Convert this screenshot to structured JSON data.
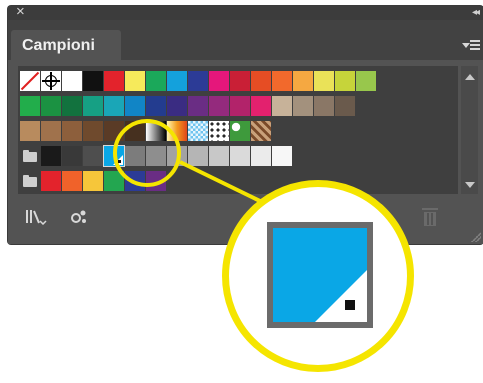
{
  "panel": {
    "title": "Campioni",
    "close_icon": "×",
    "collapse_icon": "◂◂"
  },
  "colors": {
    "panel_bg": "#535353",
    "titlebar_bg": "#3c3c3c",
    "highlight": "#f5e500",
    "selected_swatch": "#0aa7e6"
  },
  "rows": [
    {
      "name": "row-1",
      "swatches": [
        "none",
        "registration",
        "#ffffff",
        "#111111",
        "#e3232c",
        "#f6ea5b",
        "#1ba85a",
        "#14a1dc",
        "#2c3b96",
        "#e5177b",
        "#c91f36",
        "#e64d24",
        "#f2692c",
        "#f5a841",
        "#eae258",
        "#c6d43a",
        "#98c74c"
      ]
    },
    {
      "name": "row-2",
      "swatches": [
        "#22ad4b",
        "#1b9242",
        "#12723e",
        "#16a084",
        "#1aa6b7",
        "#1185c6",
        "#233c8f",
        "#3a2c82",
        "#6a2d84",
        "#942a7d",
        "#b2236a",
        "#e3216e",
        "#c7b299",
        "#a3917d",
        "#8a7766",
        "#6a5a4c"
      ]
    },
    {
      "name": "row-3",
      "swatches": [
        "#b88b5e",
        "#a0724c",
        "#8d5f3c",
        "#6f4a2d",
        "#5a3b26",
        "#46301f",
        "gradient-bw",
        "gradient-orange",
        "pattern-blue",
        "pattern-circles",
        "pattern-green",
        "pattern-brown"
      ]
    },
    {
      "name": "row-4",
      "swatches": [
        "folder",
        "#1a1a1a",
        "#393939",
        "#4e4e4e",
        "process-blue",
        "#7c7c7c",
        "#8e8e8e",
        "#a2a2a2",
        "#b5b5b5",
        "#c8c8c8",
        "#dadada",
        "#ebebeb",
        "#f7f7f7"
      ]
    },
    {
      "name": "row-5",
      "swatches": [
        "folder",
        "#e3232c",
        "#f0622a",
        "#f6c63a",
        "#23a650",
        "#2c3b96",
        "#6a2d84"
      ]
    }
  ],
  "toolbar": {
    "library_icon": "swatch-library-menu-icon",
    "kinds_icon": "show-swatch-kinds-icon",
    "trash_icon": "delete-swatch-icon"
  },
  "callout": {
    "zoom_icon": "process-color-swatch-icon"
  }
}
